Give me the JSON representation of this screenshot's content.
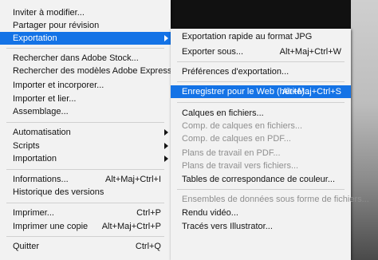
{
  "main_menu": {
    "items": [
      {
        "label": "Inviter à modifier..."
      },
      {
        "label": "Partager pour révision"
      },
      {
        "label": "Exportation"
      },
      {
        "label": "Rechercher dans Adobe Stock..."
      },
      {
        "label": "Rechercher des modèles Adobe Express..."
      },
      {
        "label": "Importer et incorporer..."
      },
      {
        "label": "Importer et lier..."
      },
      {
        "label": "Assemblage..."
      },
      {
        "label": "Automatisation"
      },
      {
        "label": "Scripts"
      },
      {
        "label": "Importation"
      },
      {
        "label": "Informations...",
        "shortcut": "Alt+Maj+Ctrl+I"
      },
      {
        "label": "Historique des versions"
      },
      {
        "label": "Imprimer...",
        "shortcut": "Ctrl+P"
      },
      {
        "label": "Imprimer une copie",
        "shortcut": "Alt+Maj+Ctrl+P"
      },
      {
        "label": "Quitter",
        "shortcut": "Ctrl+Q"
      }
    ]
  },
  "export_submenu": {
    "items": [
      {
        "label": "Exportation rapide au format JPG"
      },
      {
        "label": "Exporter sous...",
        "shortcut": "Alt+Maj+Ctrl+W"
      },
      {
        "label": "Préférences d'exportation..."
      },
      {
        "label": "Enregistrer pour le Web (hérité)...",
        "shortcut": "Alt+Maj+Ctrl+S"
      },
      {
        "label": "Calques en fichiers..."
      },
      {
        "label": "Comp. de calques en fichiers..."
      },
      {
        "label": "Comp. de calques en PDF..."
      },
      {
        "label": "Plans de travail en PDF..."
      },
      {
        "label": "Plans de travail vers fichiers..."
      },
      {
        "label": "Tables de correspondance de couleur..."
      },
      {
        "label": "Ensembles de données sous forme de fichiers..."
      },
      {
        "label": "Rendu vidéo..."
      },
      {
        "label": "Tracés vers Illustrator..."
      }
    ]
  },
  "colors": {
    "highlight": "#1473e6",
    "menu_bg": "#f2f2f2",
    "disabled_text": "#8f8f8f"
  }
}
